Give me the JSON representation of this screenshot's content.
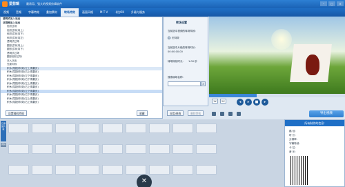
{
  "app": {
    "name": "爱剪辑",
    "subtitle": "最易用、强大的视频剪辑软件"
  },
  "tabs": [
    "视频",
    "音频",
    "字幕特效",
    "叠加素材",
    "转场特效",
    "画面风格",
    "M T V",
    "卡拉OK",
    "升级与服务"
  ],
  "effects_panel": {
    "items": [
      "透明式淡入淡出",
      "泛视频淡入淡出",
      "色阶过场",
      "色阶过场(向上)",
      "色阶过场(向下)",
      "色阶过场(向左)",
      "透明式过场",
      "圆形过场(向上)",
      "圆形过场(向下)",
      "透明式过场",
      "圆形色阶过场",
      "淡入淡出",
      "光影闪烁",
      "积木式翻页特效(左上角翻页)",
      "积木式翻页特效(右上角翻页)",
      "积木式翻页特效(左下角翻页)",
      "积木式翻页特效(右下角翻页)",
      "积木式翻页特效(左上角翻页)",
      "积木式翻页特效(右上角翻页)",
      "积木式翻页特效(左下角翻页)",
      "积木式翻页特效(右下角翻页)",
      "积木式翻页特效(左上角翻页)",
      "积木式翻页特效(右上角翻页)"
    ],
    "apply_button": "设置随机特效",
    "favorite_button": "收藏"
  },
  "settings": {
    "title": "转场设置",
    "target_label": "当前选中视频的转场特效:",
    "no_effect": "无特效",
    "duration_label": "当前选中片段的转场时长:",
    "duration_value": "00:00:00.00",
    "speed_label": "转场特效时长:",
    "speed_value": "1.00 秒",
    "search_label": "搜索转场名称:",
    "search_value": "",
    "ok_button": "应用/修改",
    "delete_button": "删除特效"
  },
  "player": {
    "speeds": [
      "1X",
      "2X"
    ],
    "export_label": "导出视频",
    "progress": 0.35
  },
  "timeline": {
    "label": "已添加片段",
    "tab": "音频"
  },
  "sidebar": {
    "title": "所有制作的信息:",
    "rows": [
      "路  径:",
      "时  长:",
      "分辨率:",
      "字幕特效:",
      "卡  拉:",
      "音  乐:"
    ]
  },
  "colors": {
    "accent": "#1f6fc6",
    "title": "#2d7fd3"
  }
}
